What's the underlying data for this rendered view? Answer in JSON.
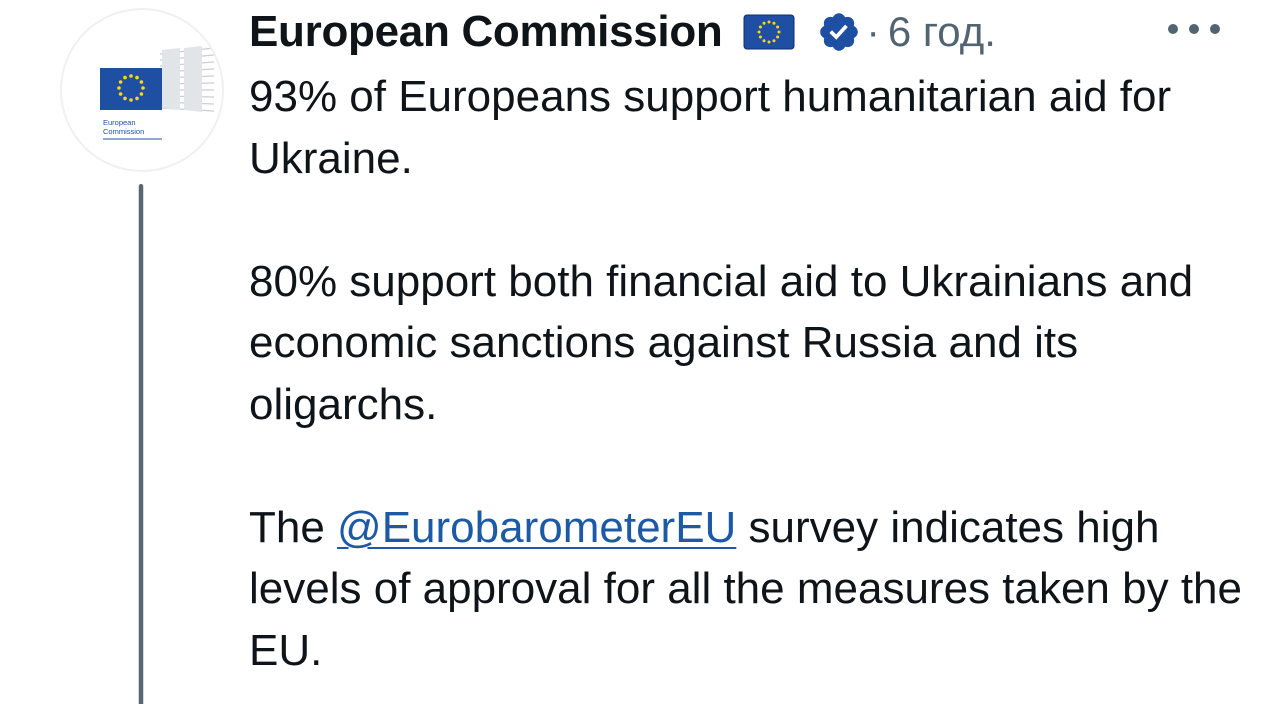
{
  "author": {
    "display_name": "European Commission",
    "flag_icon": "eu-flag-icon",
    "verified_icon": "verified-badge-icon",
    "separator": "·",
    "time": "6 год.",
    "avatar": {
      "logo_line1": "European",
      "logo_line2": "Commission",
      "flag_color": "#1f4fa3",
      "star_color": "#ffd617"
    }
  },
  "more_menu_icon": "more-horizontal-icon",
  "tweet": {
    "p1": "93% of Europeans support humanitarian aid for Ukraine.",
    "p2": "80% support both financial aid to Ukrainians and economic sanctions against Russia and its oligarchs.",
    "p3_before": "The ",
    "p3_mention": "@EurobarometerEU",
    "p3_after": " survey indicates high levels of approval for all the measures taken by the EU."
  },
  "colors": {
    "text": "#0f1419",
    "muted": "#536471",
    "link": "#1d5aa6",
    "verified": "#1d9bf0"
  }
}
